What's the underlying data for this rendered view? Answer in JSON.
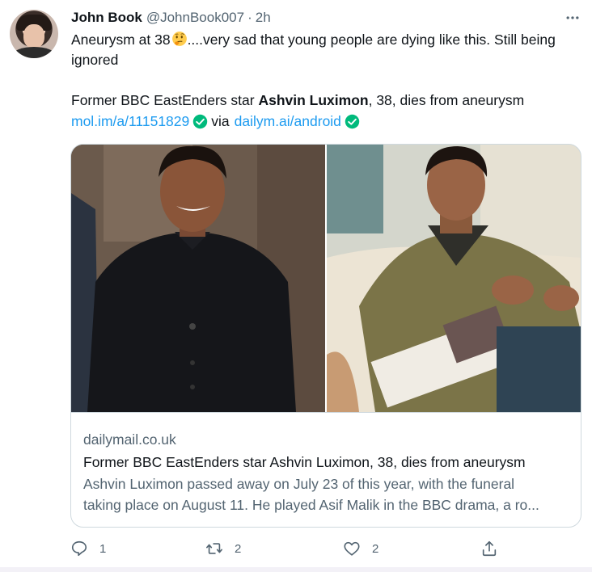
{
  "tweet": {
    "author_name": "John Book",
    "author_handle": "@JohnBook007",
    "separator": "·",
    "time": "2h",
    "text_line1": "Aneurysm at 38",
    "text_line1_rest": "....very sad that young people are dying like this. Still being ignored",
    "text_line2_prefix": "Former BBC EastEnders star ",
    "text_line2_bold": "Ashvin Luximon",
    "text_line2_suffix": ", 38, dies from aneurysm",
    "link1": "mol.im/a/11151829",
    "via": "via",
    "link2": "dailym.ai/android"
  },
  "card": {
    "domain": "dailymail.co.uk",
    "title": "Former BBC EastEnders star Ashvin Luximon, 38, dies from aneurysm",
    "desc_line1": "Ashvin Luximon passed away on July 23 of this year, with the funeral",
    "desc_line2": "taking place on August 11. He played Asif Malik in the BBC drama, a ro..."
  },
  "actions": {
    "reply_count": "1",
    "retweet_count": "2",
    "like_count": "2"
  },
  "icons": {
    "more": "more-horizontal-icon",
    "verified": "verified-check-icon",
    "reply": "reply-icon",
    "retweet": "retweet-icon",
    "like": "heart-icon",
    "share": "share-icon",
    "emoji": "thinking-face-emoji"
  },
  "colors": {
    "link": "#1d9bf0",
    "secondary_text": "#536471",
    "primary_text": "#0f1419",
    "card_border": "#cfd9de",
    "verified": "#00ba7c"
  }
}
